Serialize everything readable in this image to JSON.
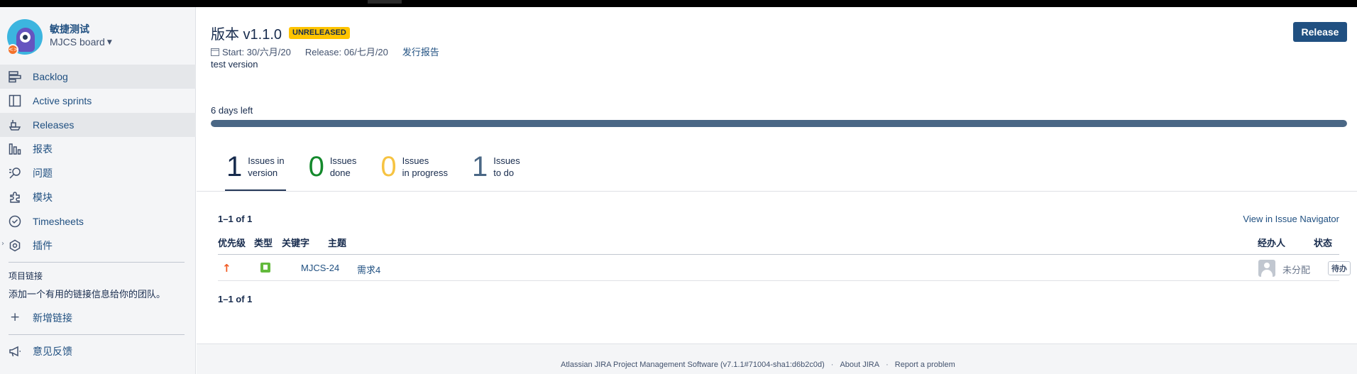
{
  "project": {
    "name": "敏捷测试",
    "board": "MJCS board"
  },
  "sidebar": {
    "items": [
      {
        "label": "Backlog",
        "icon": "backlog-icon"
      },
      {
        "label": "Active sprints",
        "icon": "sprint-board-icon"
      },
      {
        "label": "Releases",
        "icon": "ship-icon"
      },
      {
        "label": "报表",
        "icon": "reports-icon"
      },
      {
        "label": "问题",
        "icon": "issues-search-icon"
      },
      {
        "label": "模块",
        "icon": "puzzle-icon"
      },
      {
        "label": "Timesheets",
        "icon": "clock-icon"
      },
      {
        "label": "插件",
        "icon": "addons-icon"
      }
    ],
    "project_links_title": "项目链接",
    "project_links_desc": "添加一个有用的链接信息给你的团队。",
    "add_link": "新增链接",
    "feedback": "意见反馈"
  },
  "version": {
    "title": "版本 v1.1.0",
    "status": "UNRELEASED",
    "start": "Start: 30/六月/20",
    "release": "Release: 06/七月/20",
    "report_link": "发行报告",
    "description": "test version",
    "release_button": "Release",
    "days_left": "6 days left",
    "progress_fraction": 1.0
  },
  "stats": [
    {
      "count": "1",
      "label_line1": "Issues in",
      "label_line2": "version"
    },
    {
      "count": "0",
      "label_line1": "Issues",
      "label_line2": "done"
    },
    {
      "count": "0",
      "label_line1": "Issues",
      "label_line2": "in progress"
    },
    {
      "count": "1",
      "label_line1": "Issues",
      "label_line2": "to do"
    }
  ],
  "issues": {
    "count_text": "1–1 of 1",
    "navigator_link": "View in Issue Navigator",
    "columns": {
      "priority": "优先级",
      "type": "类型",
      "key": "关键字",
      "summary": "主题",
      "assignee": "经办人",
      "status": "状态"
    },
    "rows": [
      {
        "key": "MJCS-24",
        "summary": "需求4",
        "assignee": "未分配",
        "status": "待办"
      }
    ]
  },
  "footer": {
    "software": "Atlassian JIRA Project Management Software (v7.1.1#71004-sha1:d6b2c0d)",
    "about": "About JIRA",
    "report": "Report a problem"
  },
  "colors": {
    "brand": "#205081",
    "lozenge_unreleased": "#ffc400",
    "done": "#14892c",
    "in_progress": "#f6c342",
    "todo": "#4a6785"
  }
}
